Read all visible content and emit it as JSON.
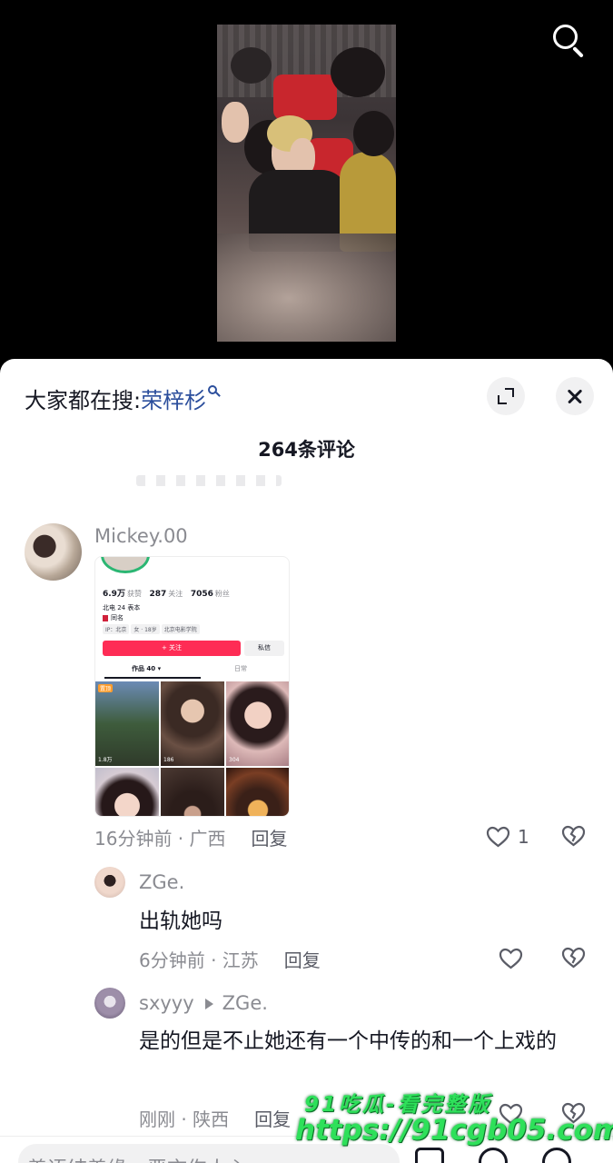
{
  "video": {
    "search_icon": "search-icon"
  },
  "sheet": {
    "trending_prefix": "大家都在搜:",
    "trending_keyword": "荣梓杉",
    "comment_count_label": "264条评论"
  },
  "comments": [
    {
      "username": "Mickey.00",
      "time_location": "16分钟前 · 广西",
      "reply_label": "回复",
      "likes": "1",
      "embedded_profile": {
        "stats": [
          {
            "value": "6.9万",
            "label": "获赞"
          },
          {
            "value": "287",
            "label": "关注"
          },
          {
            "value": "7056",
            "label": "粉丝"
          }
        ],
        "bio_line1": "北电 24 表本",
        "bio_line2": "同名",
        "tags": [
          "IP：北京",
          "女 · 18岁",
          "北京电影学院"
        ],
        "follow_label": "+ 关注",
        "message_label": "私信",
        "tab_works": "作品 40 ▾",
        "tab_daily": "日常",
        "pinned_label": "置顶",
        "counts": [
          "1.8万",
          "186",
          "304"
        ]
      }
    },
    {
      "username": "ZGe.",
      "text": "出轨她吗",
      "time_location": "6分钟前 · 江苏",
      "reply_label": "回复"
    },
    {
      "username": "sxyyy",
      "reply_to": "ZGe.",
      "text": "是的但是不止她还有一个中传的和一个上戏的",
      "time_location": "刚刚 · 陕西",
      "reply_label": "回复"
    }
  ],
  "watermark": {
    "line1": "91吃瓜-看完整版",
    "line2": "https://91cgb05.com"
  },
  "input_bar": {
    "placeholder": "善语结善缘，恶言伤人心"
  }
}
